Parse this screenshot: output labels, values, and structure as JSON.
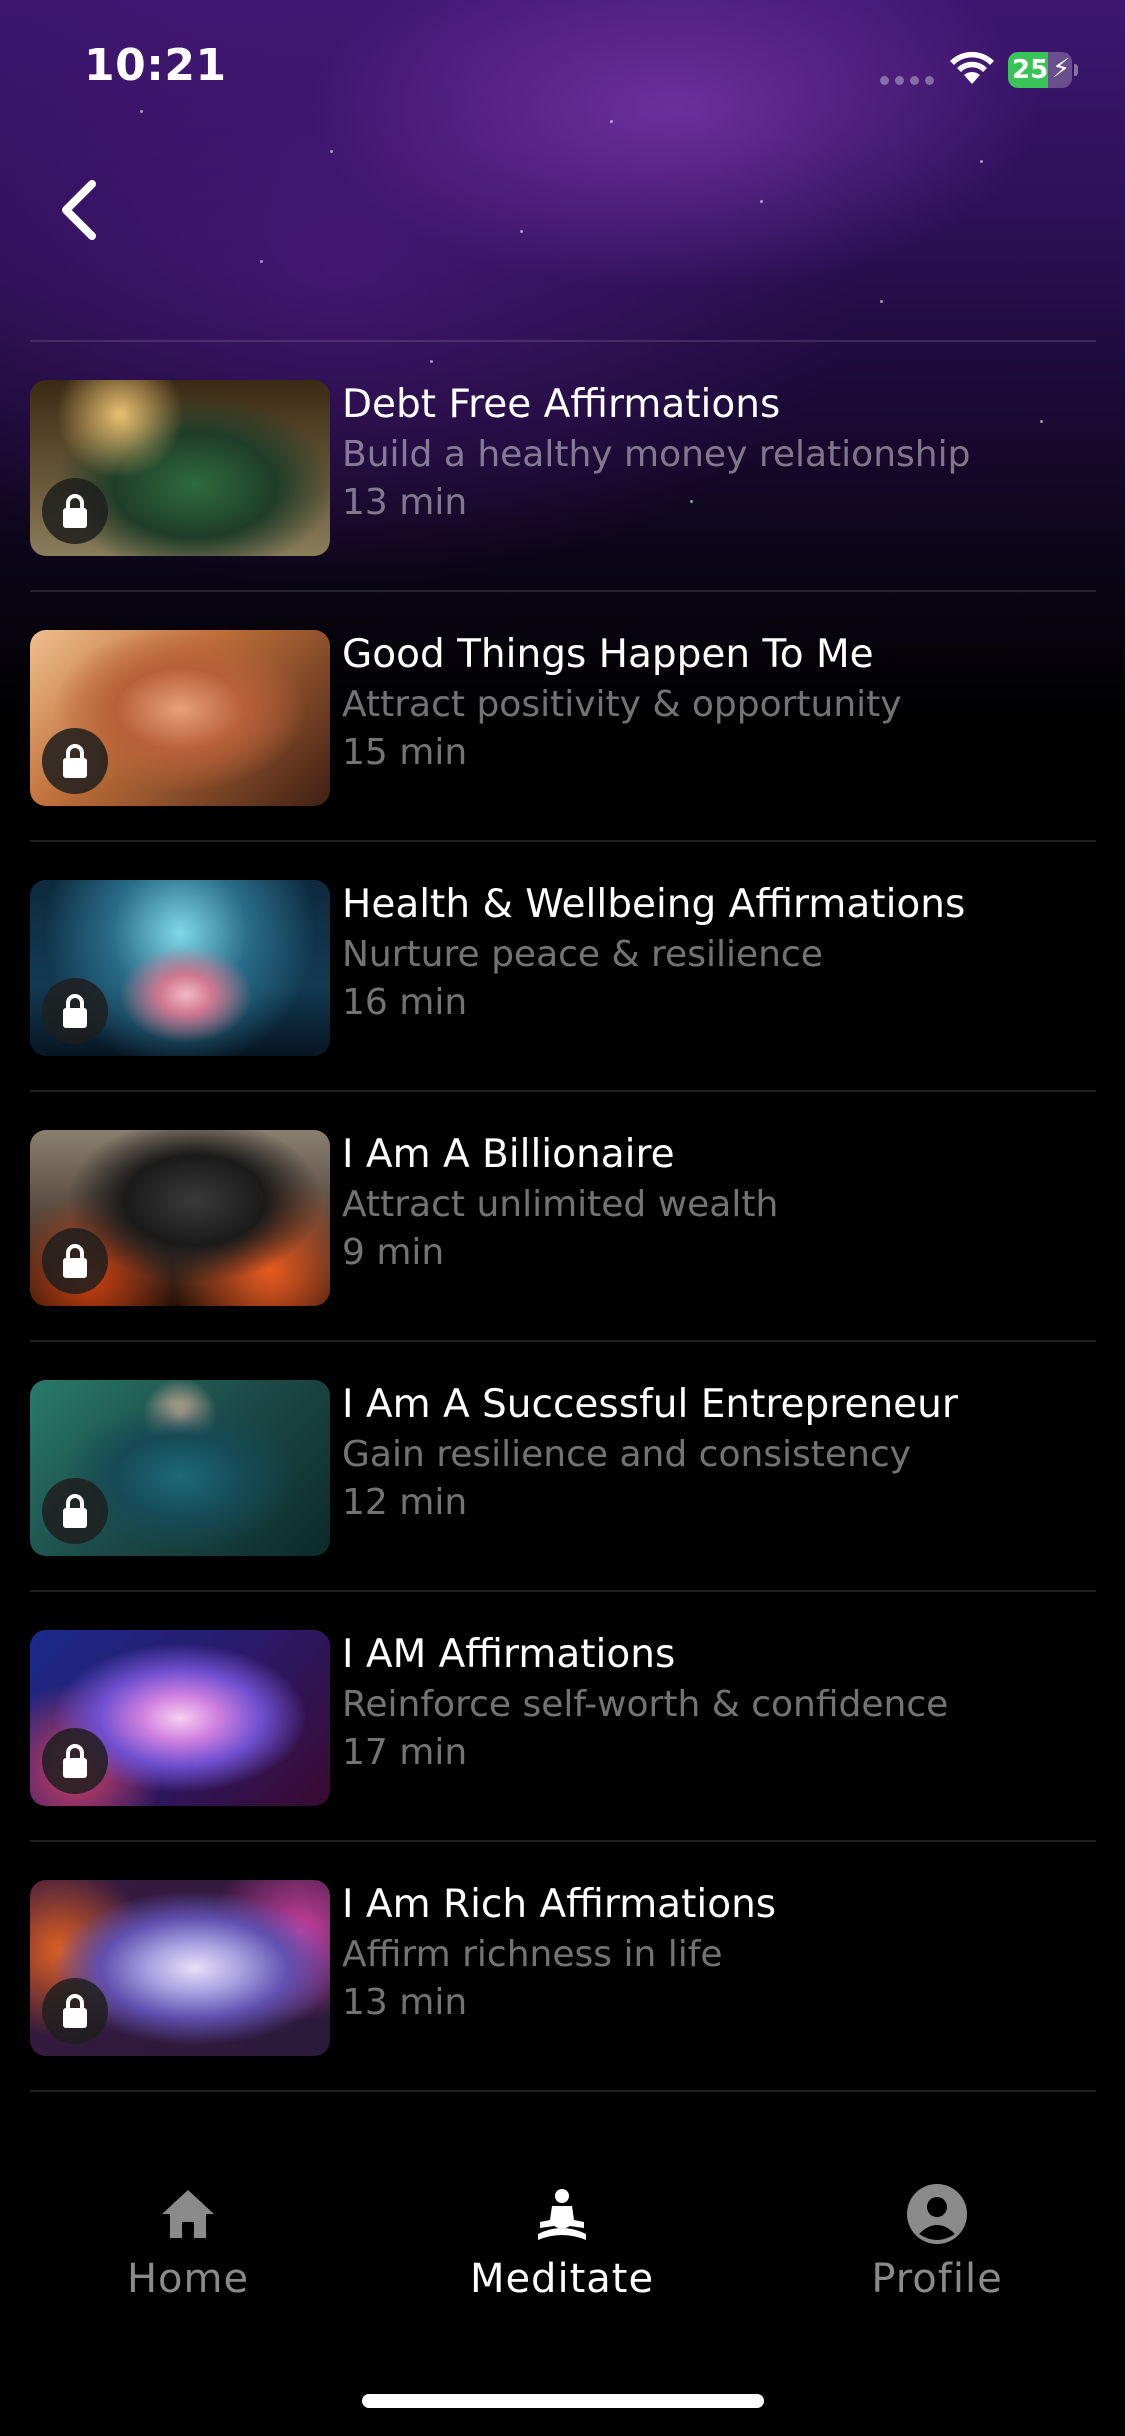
{
  "status_bar": {
    "time": "10:21",
    "battery": "25"
  },
  "colors": {
    "accent_purple": "#3e1670",
    "text_muted": "#8a8a8a",
    "battery_green": "#39c45a"
  },
  "items": [
    {
      "title": "Debt Free Affirmations",
      "subtitle": "Build a healthy money relationship",
      "duration": "13 min",
      "locked": true
    },
    {
      "title": "Good Things Happen To Me",
      "subtitle": "Attract positivity & opportunity",
      "duration": "15 min",
      "locked": true
    },
    {
      "title": "Health & Wellbeing Affirmations",
      "subtitle": "Nurture peace & resilience",
      "duration": "16 min",
      "locked": true
    },
    {
      "title": "I Am A Billionaire",
      "subtitle": "Attract unlimited wealth",
      "duration": "9 min",
      "locked": true
    },
    {
      "title": "I Am A Successful Entrepreneur",
      "subtitle": "Gain resilience and consistency",
      "duration": "12 min",
      "locked": true
    },
    {
      "title": "I AM Affirmations",
      "subtitle": "Reinforce self-worth & confidence",
      "duration": "17 min",
      "locked": true
    },
    {
      "title": "I Am Rich Affirmations",
      "subtitle": "Affirm richness in life",
      "duration": "13 min",
      "locked": true
    }
  ],
  "tabs": [
    {
      "label": "Home",
      "icon": "home-icon",
      "active": false
    },
    {
      "label": "Meditate",
      "icon": "meditate-icon",
      "active": true
    },
    {
      "label": "Profile",
      "icon": "profile-icon",
      "active": false
    }
  ]
}
